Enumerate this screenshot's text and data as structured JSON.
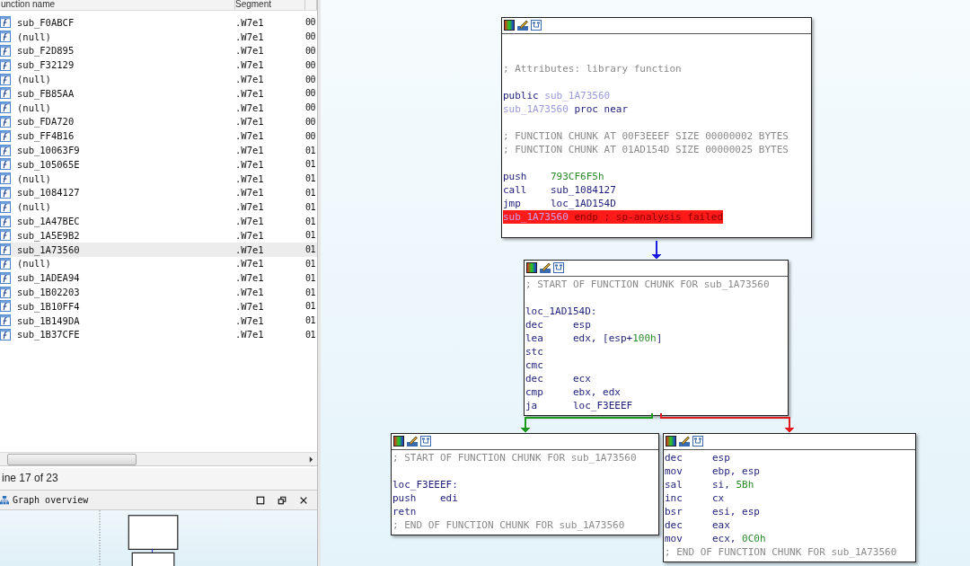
{
  "functions_window": {
    "columns": [
      "unction name",
      "Segment"
    ],
    "rows": [
      {
        "name": "sub_F0ABCF",
        "segment": ".W7e1",
        "column_3": "00",
        "selected": false
      },
      {
        "name": "(null)",
        "segment": ".W7e1",
        "column_3": "00",
        "selected": false
      },
      {
        "name": "sub_F2D895",
        "segment": ".W7e1",
        "column_3": "00",
        "selected": false
      },
      {
        "name": "sub_F32129",
        "segment": ".W7e1",
        "column_3": "00",
        "selected": false
      },
      {
        "name": "(null)",
        "segment": ".W7e1",
        "column_3": "00",
        "selected": false
      },
      {
        "name": "sub_FB85AA",
        "segment": ".W7e1",
        "column_3": "00",
        "selected": false
      },
      {
        "name": "(null)",
        "segment": ".W7e1",
        "column_3": "00",
        "selected": false
      },
      {
        "name": "sub_FDA720",
        "segment": ".W7e1",
        "column_3": "00",
        "selected": false
      },
      {
        "name": "sub_FF4B16",
        "segment": ".W7e1",
        "column_3": "00",
        "selected": false
      },
      {
        "name": "sub_10063F9",
        "segment": ".W7e1",
        "column_3": "01",
        "selected": false
      },
      {
        "name": "sub_105065E",
        "segment": ".W7e1",
        "column_3": "01",
        "selected": false
      },
      {
        "name": "(null)",
        "segment": ".W7e1",
        "column_3": "01",
        "selected": false
      },
      {
        "name": "sub_1084127",
        "segment": ".W7e1",
        "column_3": "01",
        "selected": false
      },
      {
        "name": "(null)",
        "segment": ".W7e1",
        "column_3": "01",
        "selected": false
      },
      {
        "name": "sub_1A47BEC",
        "segment": ".W7e1",
        "column_3": "01",
        "selected": false
      },
      {
        "name": "sub_1A5E9B2",
        "segment": ".W7e1",
        "column_3": "01",
        "selected": false
      },
      {
        "name": "sub_1A73560",
        "segment": ".W7e1",
        "column_3": "01",
        "selected": true
      },
      {
        "name": "(null)",
        "segment": ".W7e1",
        "column_3": "01",
        "selected": false
      },
      {
        "name": "sub_1ADEA94",
        "segment": ".W7e1",
        "column_3": "01",
        "selected": false
      },
      {
        "name": "sub_1B02203",
        "segment": ".W7e1",
        "column_3": "01",
        "selected": false
      },
      {
        "name": "sub_1B10FF4",
        "segment": ".W7e1",
        "column_3": "01",
        "selected": false
      },
      {
        "name": "sub_1B149DA",
        "segment": ".W7e1",
        "column_3": "01",
        "selected": false
      },
      {
        "name": "sub_1B37CFE",
        "segment": ".W7e1",
        "column_3": "01",
        "selected": false
      }
    ]
  },
  "status_bar": "ine 17 of 23",
  "graph_overview": {
    "title": "Graph overview"
  },
  "graph": {
    "nodes": [
      {
        "lines": [
          {
            "kind": "blank"
          },
          {
            "kind": "blank"
          },
          {
            "kind": "code",
            "tokens": [
              {
                "text": "; Attributes: library function",
                "kind": "comment"
              }
            ]
          },
          {
            "kind": "blank"
          },
          {
            "kind": "code",
            "tokens": [
              {
                "text": "public",
                "kind": "keyword"
              },
              {
                "text": " sub_1A73560",
                "kind": "name"
              }
            ]
          },
          {
            "kind": "code",
            "tokens": [
              {
                "text": "sub_1A73560",
                "kind": "name"
              },
              {
                "text": " proc near",
                "kind": "keyword"
              }
            ]
          },
          {
            "kind": "blank"
          },
          {
            "kind": "code",
            "tokens": [
              {
                "text": "; FUNCTION CHUNK AT 00F3EEEF SIZE 00000002 BYTES",
                "kind": "comment"
              }
            ]
          },
          {
            "kind": "code",
            "tokens": [
              {
                "text": "; FUNCTION CHUNK AT 01AD154D SIZE 00000025 BYTES",
                "kind": "comment"
              }
            ]
          },
          {
            "kind": "blank"
          },
          {
            "kind": "code",
            "op": "push",
            "tokens": [
              {
                "text": "793CF6F5h",
                "kind": "number"
              }
            ]
          },
          {
            "kind": "code",
            "op": "call",
            "tokens": [
              {
                "text": "sub_1084127",
                "kind": "operand"
              }
            ]
          },
          {
            "kind": "code",
            "op": "jmp",
            "tokens": [
              {
                "text": "loc_1AD154D",
                "kind": "operand"
              }
            ]
          },
          {
            "kind": "code",
            "highlight": true,
            "tokens": [
              {
                "text": "sub_1A73560",
                "kind": "name"
              },
              {
                "text": " endp ; sp-analysis failed",
                "kind": "keyword"
              }
            ]
          }
        ]
      },
      {
        "lines": [
          {
            "kind": "code",
            "tokens": [
              {
                "text": "; START OF FUNCTION CHUNK FOR sub_1A73560",
                "kind": "comment"
              }
            ]
          },
          {
            "kind": "blank"
          },
          {
            "kind": "code",
            "tokens": [
              {
                "text": "loc_1AD154D:",
                "kind": "operand"
              }
            ]
          },
          {
            "kind": "code",
            "op": "dec",
            "tokens": [
              {
                "text": "esp",
                "kind": "operand"
              }
            ]
          },
          {
            "kind": "code",
            "op": "lea",
            "tokens": [
              {
                "text": "edx, [esp+",
                "kind": "operand"
              },
              {
                "text": "100h",
                "kind": "number"
              },
              {
                "text": "]",
                "kind": "operand"
              }
            ]
          },
          {
            "kind": "code",
            "op": "stc"
          },
          {
            "kind": "code",
            "op": "cmc"
          },
          {
            "kind": "code",
            "op": "dec",
            "tokens": [
              {
                "text": "ecx",
                "kind": "operand"
              }
            ]
          },
          {
            "kind": "code",
            "op": "cmp",
            "tokens": [
              {
                "text": "ebx, edx",
                "kind": "operand"
              }
            ]
          },
          {
            "kind": "code",
            "op": "ja",
            "tokens": [
              {
                "text": "loc_F3EEEF",
                "kind": "operand"
              }
            ]
          }
        ]
      },
      {
        "lines": [
          {
            "kind": "code",
            "tokens": [
              {
                "text": "; START OF FUNCTION CHUNK FOR sub_1A73560",
                "kind": "comment"
              }
            ]
          },
          {
            "kind": "blank"
          },
          {
            "kind": "code",
            "tokens": [
              {
                "text": "loc_F3EEEF:",
                "kind": "operand"
              }
            ]
          },
          {
            "kind": "code",
            "op": "push",
            "tokens": [
              {
                "text": "edi",
                "kind": "operand"
              }
            ]
          },
          {
            "kind": "code",
            "op": "retn"
          },
          {
            "kind": "code",
            "tokens": [
              {
                "text": "; END OF FUNCTION CHUNK FOR sub_1A73560",
                "kind": "comment"
              }
            ]
          }
        ]
      },
      {
        "lines": [
          {
            "kind": "code",
            "op": "dec",
            "tokens": [
              {
                "text": "esp",
                "kind": "operand"
              }
            ]
          },
          {
            "kind": "code",
            "op": "mov",
            "tokens": [
              {
                "text": "ebp, esp",
                "kind": "operand"
              }
            ]
          },
          {
            "kind": "code",
            "op": "sal",
            "tokens": [
              {
                "text": "si, ",
                "kind": "operand"
              },
              {
                "text": "5Bh",
                "kind": "number"
              }
            ]
          },
          {
            "kind": "code",
            "op": "inc",
            "tokens": [
              {
                "text": "cx",
                "kind": "operand"
              }
            ]
          },
          {
            "kind": "code",
            "op": "bsr",
            "tokens": [
              {
                "text": "esi, esp",
                "kind": "operand"
              }
            ]
          },
          {
            "kind": "code",
            "op": "dec",
            "tokens": [
              {
                "text": "eax",
                "kind": "operand"
              }
            ]
          },
          {
            "kind": "code",
            "op": "mov",
            "tokens": [
              {
                "text": "ecx, ",
                "kind": "operand"
              },
              {
                "text": "0C0h",
                "kind": "number"
              }
            ]
          },
          {
            "kind": "code",
            "tokens": [
              {
                "text": "; END OF FUNCTION CHUNK FOR sub_1A73560",
                "kind": "comment"
              }
            ]
          }
        ]
      }
    ],
    "edges": [
      {
        "color": "#1a1ae0"
      },
      {
        "color": "#1a9a1a"
      },
      {
        "color": "#e01a1a"
      }
    ]
  }
}
